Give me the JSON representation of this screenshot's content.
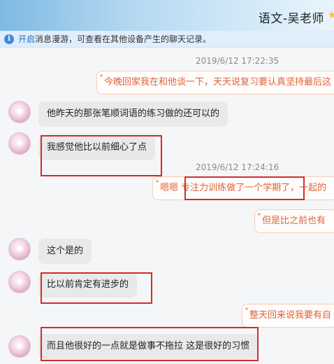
{
  "window": {
    "title": "语文-吴老师"
  },
  "notice": {
    "link_text": "开启",
    "text": "消息漫游，可查看在其他设备产生的聊天记录。"
  },
  "messages": {
    "ts1": "2019/6/12 17:22:35",
    "m1": "今晚回家我在和他谈一下，天天说复习要认真坚持最后这",
    "m2": "他昨天的那张笔顺词语的练习做的还可以的",
    "m3": "我感觉他比以前细心了点",
    "ts2": "2019/6/12 17:24:16",
    "m4": "嗯嗯 专注力训练做了一个学期了，一起的",
    "m5": "但是比之前也有",
    "m6": "这个是的",
    "m7": "比以前肯定有进步的",
    "m8": "整天回来说我要有自",
    "m9": "而且他很好的一点就是做事不拖拉 这是很好的习惯"
  },
  "colors": {
    "highlight_box": "#d32b2b",
    "sent_text": "#e0623a",
    "link": "#1f6fc8"
  }
}
